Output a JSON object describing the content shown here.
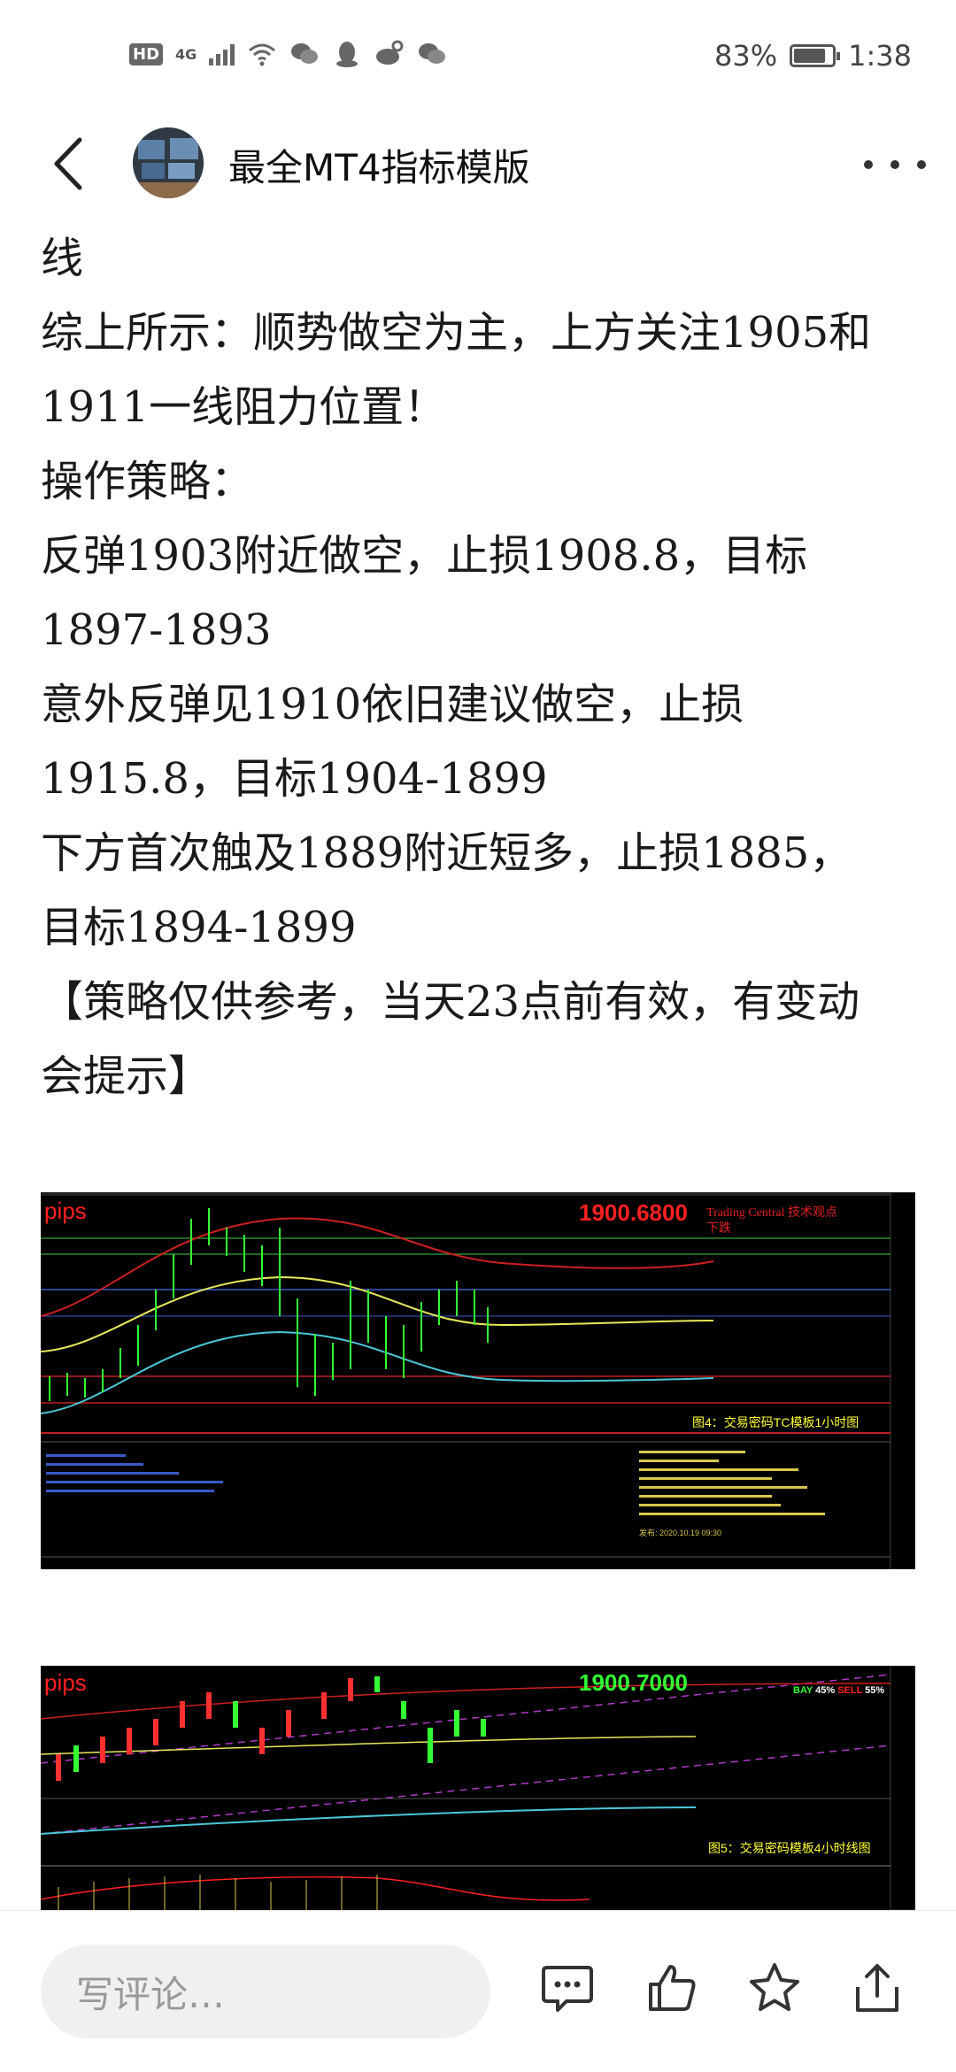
{
  "status_bar": {
    "hd": "HD",
    "network": "4G",
    "battery_percent": "83%",
    "battery_level": 0.83,
    "time": "1:38"
  },
  "header": {
    "title": "最全MT4指标模版"
  },
  "article": {
    "lines": [
      "线",
      "综上所示：顺势做空为主，上方关注1905和",
      "1911一线阻力位置！",
      "操作策略：",
      "反弹1903附近做空，止损1908.8，目标",
      "1897-1893",
      "意外反弹见1910依旧建议做空，止损",
      "1915.8，目标1904-1899",
      "下方首次触及1889附近短多，止损1885，",
      "目标1894-1899",
      "【策略仅供参考，当天23点前有效，有变动",
      "会提示】"
    ]
  },
  "chart1": {
    "logo": "pips",
    "price": "1900.6800",
    "source": "Trading Central 技术观点",
    "direction": "下跌",
    "caption": "图4：交易密码TC模板1小时图",
    "forecast_time": "发布: 2020.10.19 09:30"
  },
  "chart2": {
    "logo": "pips",
    "price": "1900.7000",
    "buy_label": "BAY",
    "buy_pct": "45%",
    "sell_label": "SELL",
    "sell_pct": "55%",
    "caption": "图5：交易密码模板4小时线图"
  },
  "bottom_bar": {
    "comment_placeholder": "写评论…"
  },
  "colors": {
    "chart_bg": "#000000",
    "price_red": "#ff2020",
    "price_green": "#33ff33",
    "caption_yellow": "#ffff33"
  }
}
